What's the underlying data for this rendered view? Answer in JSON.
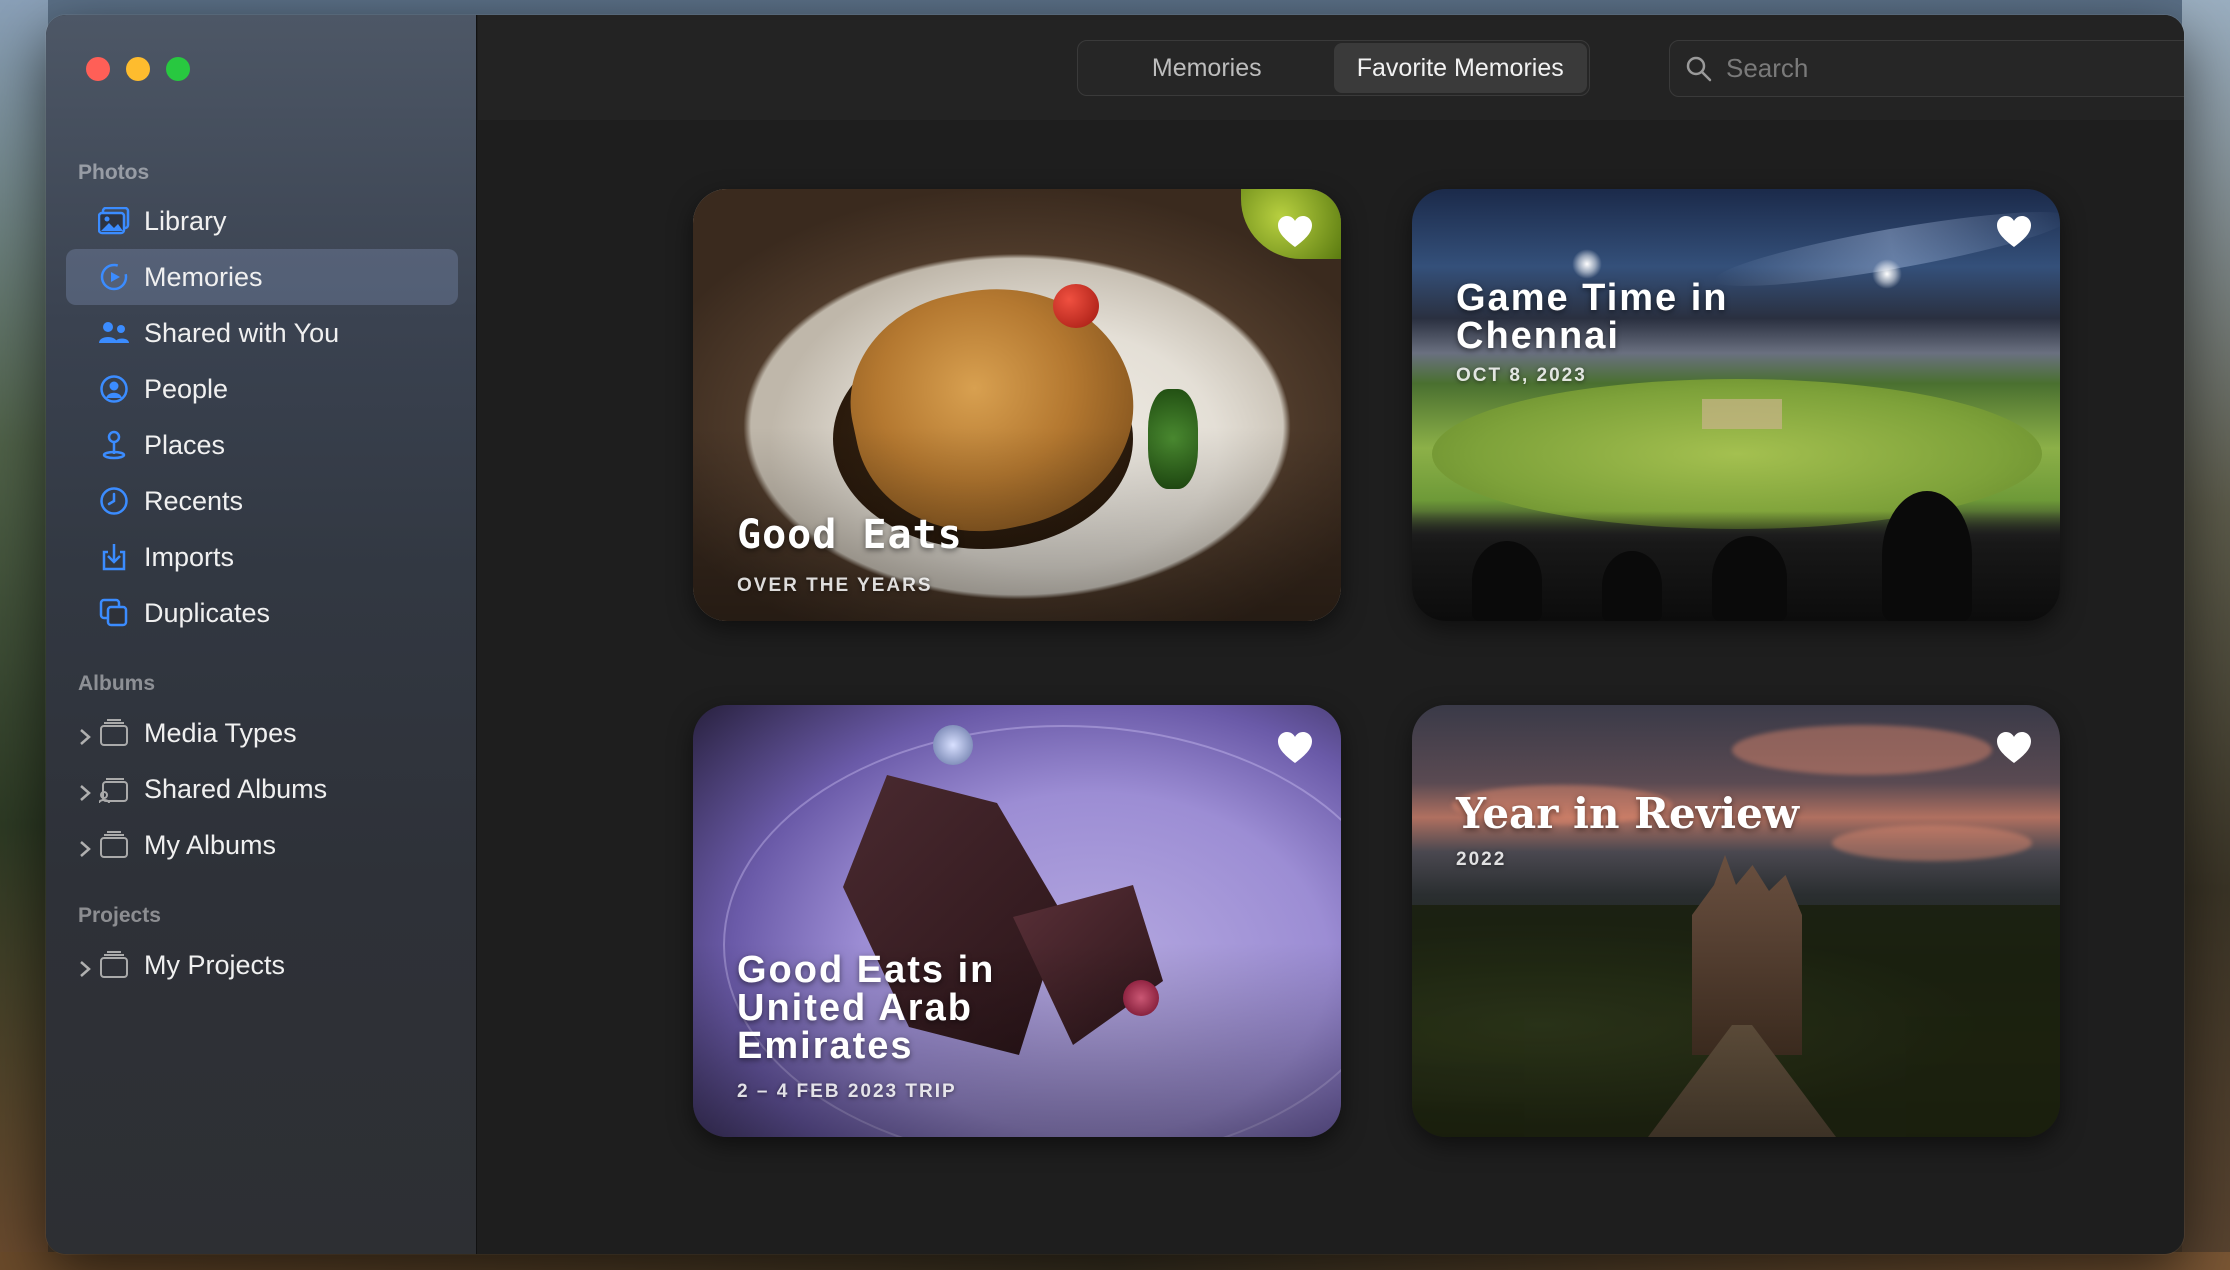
{
  "toolbar": {
    "tabs": [
      {
        "label": "Memories",
        "selected": false
      },
      {
        "label": "Favorite Memories",
        "selected": true
      }
    ],
    "search_placeholder": "Search"
  },
  "sidebar": {
    "sections": {
      "photos": "Photos",
      "albums": "Albums",
      "projects": "Projects"
    },
    "photos_items": [
      {
        "label": "Library",
        "icon": "library-icon"
      },
      {
        "label": "Memories",
        "icon": "memories-icon",
        "active": true
      },
      {
        "label": "Shared with You",
        "icon": "shared-with-you-icon"
      },
      {
        "label": "People",
        "icon": "people-icon"
      },
      {
        "label": "Places",
        "icon": "places-icon"
      },
      {
        "label": "Recents",
        "icon": "recents-icon"
      },
      {
        "label": "Imports",
        "icon": "imports-icon"
      },
      {
        "label": "Duplicates",
        "icon": "duplicates-icon"
      }
    ],
    "album_items": [
      {
        "label": "Media Types",
        "icon": "folder-icon"
      },
      {
        "label": "Shared Albums",
        "icon": "shared-folder-icon"
      },
      {
        "label": "My Albums",
        "icon": "folder-icon"
      }
    ],
    "project_items": [
      {
        "label": "My Projects",
        "icon": "folder-icon"
      }
    ]
  },
  "memories": [
    {
      "title": "Good Eats",
      "subtitle": "OVER THE YEARS",
      "favorite": true
    },
    {
      "title": "Game Time in Chennai",
      "subtitle": "OCT 8, 2023",
      "favorite": true
    },
    {
      "title": "Good Eats in United Arab Emirates",
      "subtitle": "2 – 4 FEB 2023 TRIP",
      "favorite": true
    },
    {
      "title": "Year in Review",
      "subtitle": "2022",
      "favorite": true
    }
  ],
  "colors": {
    "accent": "#3b8cff",
    "sidebar_selection": "#5a6a88"
  }
}
